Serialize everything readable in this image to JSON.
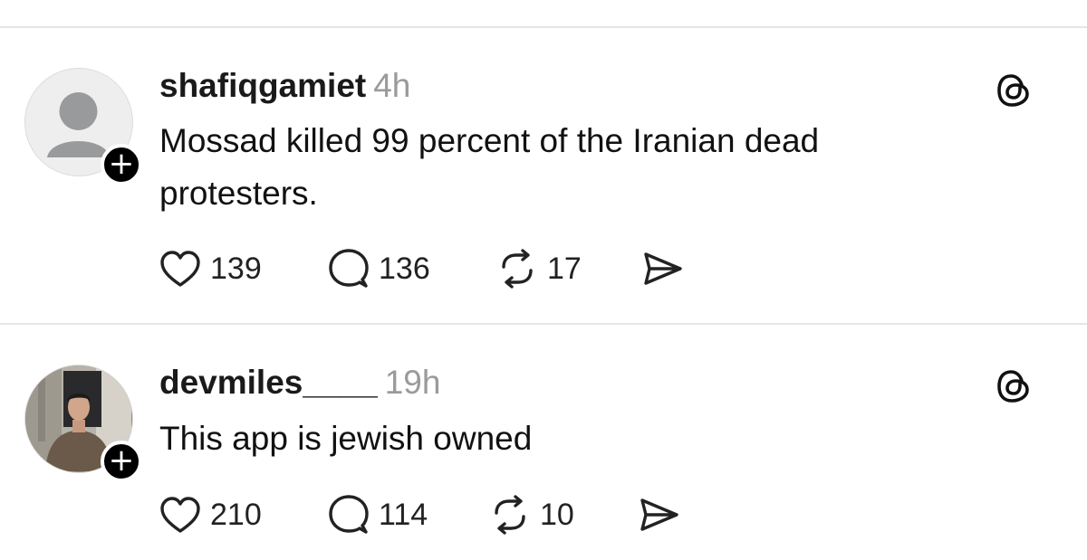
{
  "posts": [
    {
      "username": "shafiqgamiet",
      "time": "4h",
      "text": "Mossad killed 99 percent of the Iranian dead protesters.",
      "avatar": "default-avatar",
      "likes": "139",
      "replies": "136",
      "reposts": "17"
    },
    {
      "username": "devmiles____",
      "time": "19h",
      "text": "This app is jewish owned",
      "avatar": "photo-avatar",
      "likes": "210",
      "replies": "114",
      "reposts": "10"
    }
  ],
  "icons": {
    "follow": "plus-icon",
    "brand": "threads-logo-icon",
    "like": "heart-icon",
    "reply": "comment-icon",
    "repost": "repost-icon",
    "share": "send-icon"
  },
  "colors": {
    "text": "#111111",
    "muted": "#9a9a9a",
    "divider": "#e6e6e6"
  }
}
